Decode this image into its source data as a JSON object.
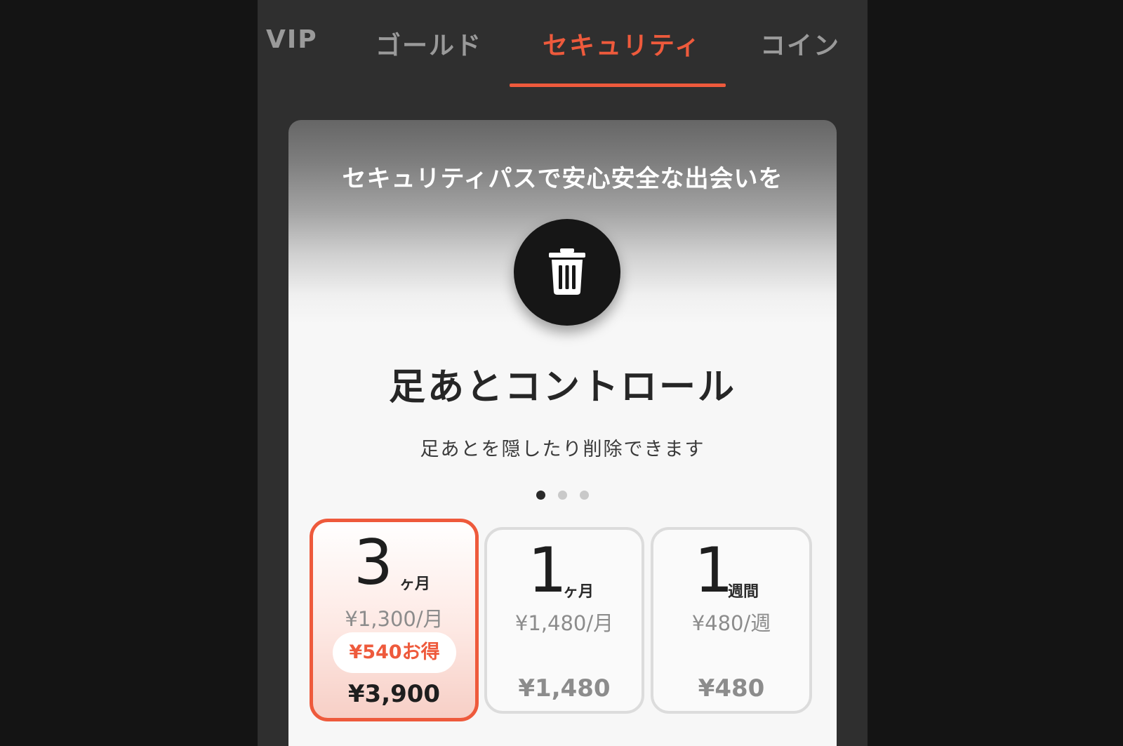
{
  "tabs": [
    {
      "label": "VIP",
      "active": false
    },
    {
      "label": "ゴールド",
      "active": false
    },
    {
      "label": "セキュリティ",
      "active": true
    },
    {
      "label": "コイン",
      "active": false
    }
  ],
  "card": {
    "headline": "セキュリティパスで安心安全な出会いを",
    "feature_icon": "trash-icon",
    "feature_title": "足あとコントロール",
    "feature_description": "足あとを隠したり削除できます",
    "carousel": {
      "total": 3,
      "current": 1
    }
  },
  "plans": [
    {
      "number": "3",
      "unit": "ヶ月",
      "rate": "¥1,300/月",
      "badge": "¥540お得",
      "total": "¥3,900",
      "selected": true
    },
    {
      "number": "1",
      "unit": "ヶ月",
      "rate": "¥1,480/月",
      "total": "¥1,480",
      "selected": false
    },
    {
      "number": "1",
      "unit": "週間",
      "rate": "¥480/週",
      "total": "¥480",
      "selected": false
    }
  ],
  "colors": {
    "accent": "#ee5a3c",
    "background": "#2f2f2f",
    "card": "#f7f7f7"
  }
}
